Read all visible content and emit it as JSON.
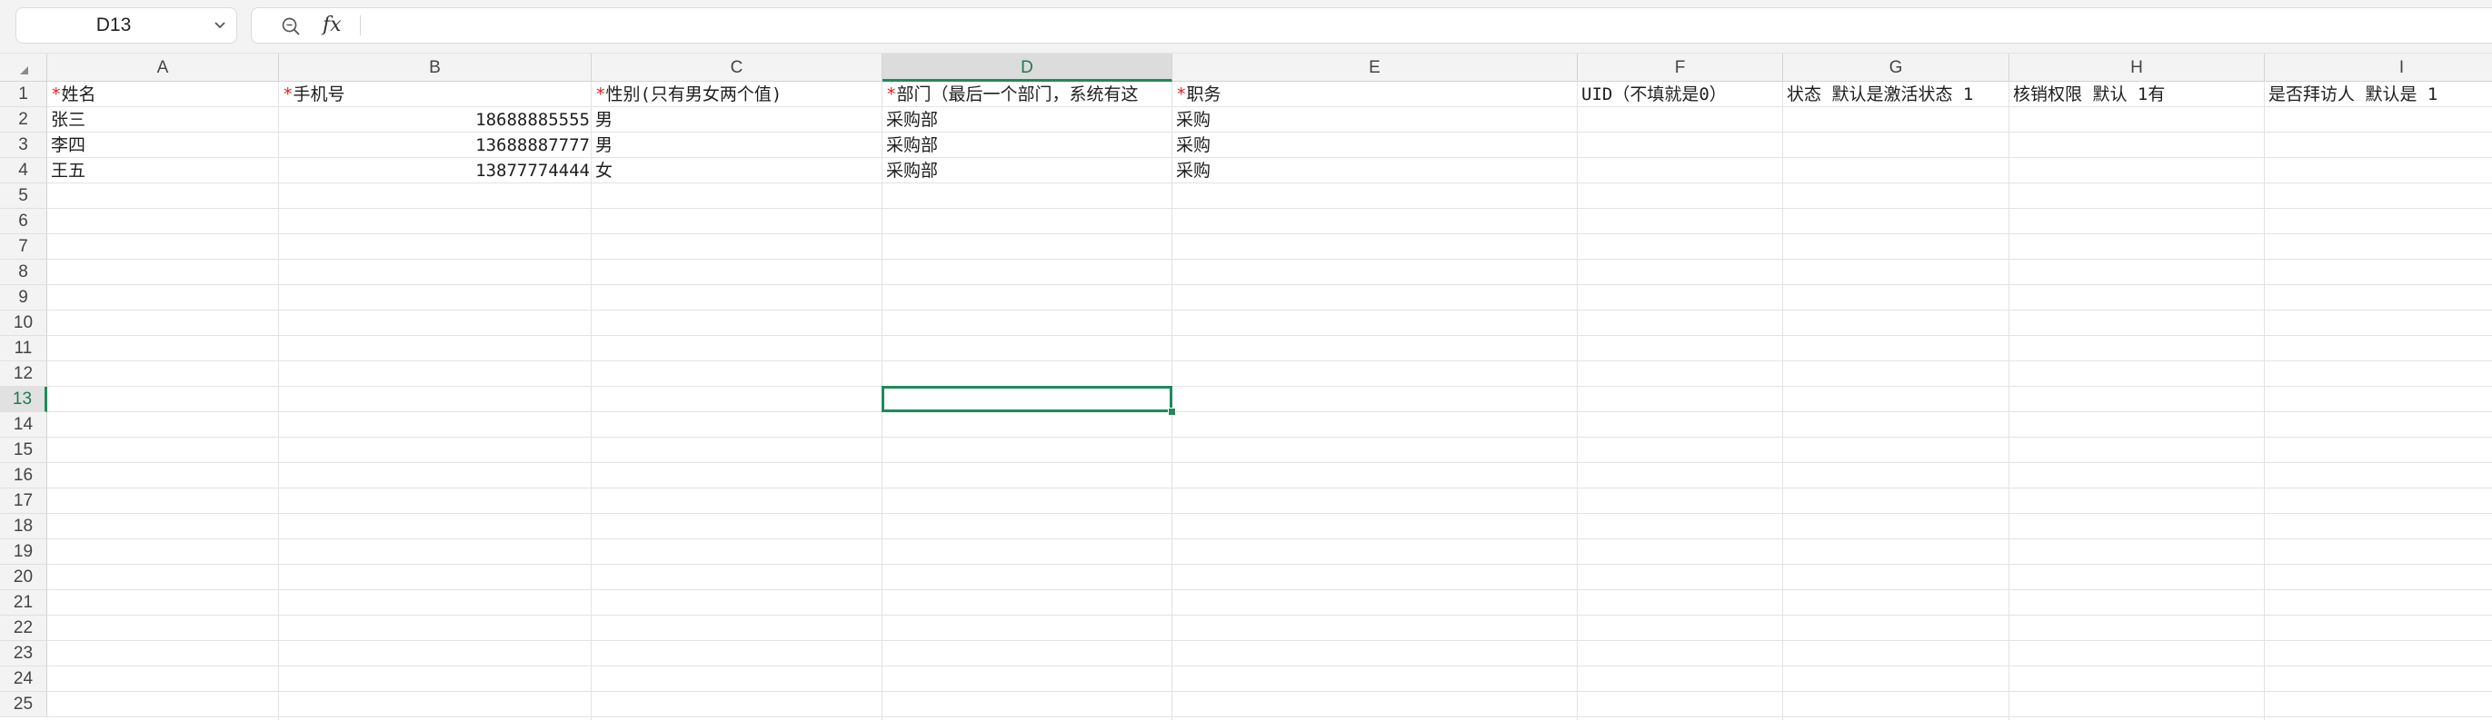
{
  "formula_bar": {
    "name_box": "D13",
    "fx_label": "fx",
    "formula_value": ""
  },
  "icons": {
    "name_box_dropdown": "chevron-down-icon",
    "zoom": "zoom-icon",
    "fx": "function-icon",
    "select_all": "select-all-triangle-icon"
  },
  "colors": {
    "accent": "#1f8a5a",
    "required_marker": "#e02020",
    "header_bg": "#f3f3f3",
    "gridline": "#e3e3e3"
  },
  "grid": {
    "active_cell": "D13",
    "columns": [
      "A",
      "B",
      "C",
      "D",
      "E",
      "F",
      "G",
      "H",
      "I"
    ],
    "rows": [
      "1",
      "2",
      "3",
      "4",
      "5",
      "6",
      "7",
      "8",
      "9",
      "10",
      "11",
      "12",
      "13",
      "14",
      "15",
      "16",
      "17",
      "18",
      "19",
      "20",
      "21",
      "22",
      "23",
      "24",
      "25"
    ],
    "cells": [
      {
        "ref": "A1",
        "required": "*",
        "text": "姓名"
      },
      {
        "ref": "B1",
        "required": "*",
        "text": "手机号"
      },
      {
        "ref": "C1",
        "required": "*",
        "text": "性别(只有男女两个值)"
      },
      {
        "ref": "D1",
        "required": "*",
        "text": "部门（最后一个部门，系统有这"
      },
      {
        "ref": "E1",
        "required": "*",
        "text": "职务"
      },
      {
        "ref": "F1",
        "required": "",
        "text": "UID（不填就是0）"
      },
      {
        "ref": "G1",
        "required": "",
        "text": "状态 默认是激活状态  1"
      },
      {
        "ref": "H1",
        "required": "",
        "text": "核销权限 默认 1有"
      },
      {
        "ref": "I1",
        "required": "",
        "text": "是否拜访人  默认是 1"
      },
      {
        "ref": "A2",
        "required": "",
        "text": "张三"
      },
      {
        "ref": "B2",
        "required": "",
        "text": "18688885555"
      },
      {
        "ref": "C2",
        "required": "",
        "text": "男"
      },
      {
        "ref": "D2",
        "required": "",
        "text": "采购部"
      },
      {
        "ref": "E2",
        "required": "",
        "text": "采购"
      },
      {
        "ref": "A3",
        "required": "",
        "text": "李四"
      },
      {
        "ref": "B3",
        "required": "",
        "text": "13688887777"
      },
      {
        "ref": "C3",
        "required": "",
        "text": "男"
      },
      {
        "ref": "D3",
        "required": "",
        "text": "采购部"
      },
      {
        "ref": "E3",
        "required": "",
        "text": "采购"
      },
      {
        "ref": "A4",
        "required": "",
        "text": "王五"
      },
      {
        "ref": "B4",
        "required": "",
        "text": "13877774444"
      },
      {
        "ref": "C4",
        "required": "",
        "text": "女"
      },
      {
        "ref": "D4",
        "required": "",
        "text": "采购部"
      },
      {
        "ref": "E4",
        "required": "",
        "text": "采购"
      }
    ]
  }
}
